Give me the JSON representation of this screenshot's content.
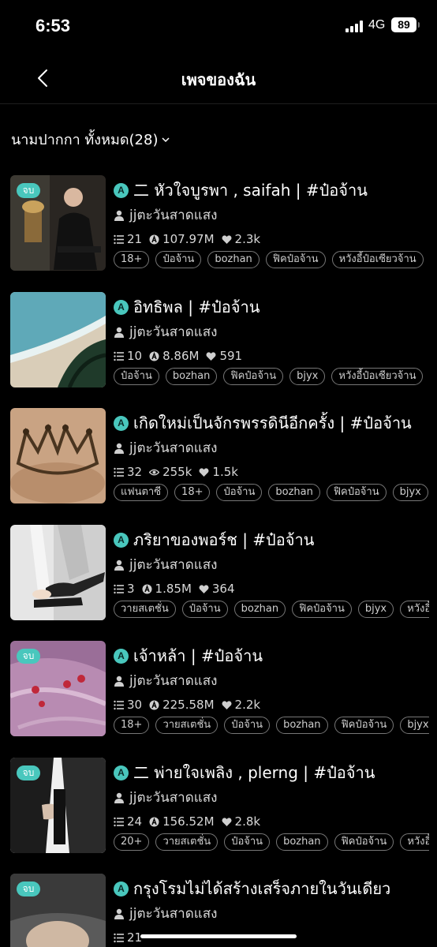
{
  "status_bar": {
    "time": "6:53",
    "network": "4G",
    "battery": "89"
  },
  "nav": {
    "title": "เพจของฉัน"
  },
  "filter": {
    "label": "นามปากกา ทั้งหมด(28)"
  },
  "colors": {
    "accent": "#49c7bd",
    "background": "#000000"
  },
  "stories": [
    {
      "badge": "จบ",
      "title": "二 หัวใจบูรพา , saifah | #ป๋อจ้าน",
      "author": "jjตะวันสาดแสง",
      "chapters": "21",
      "views_icon": "a-coin-icon",
      "views": "107.97M",
      "likes": "2.3k",
      "tags": [
        "18+",
        "ป๋อจ้าน",
        "bozhan",
        "ฟิคป๋อจ้าน",
        "หวังอี้ป๋อเซียวจ้าน"
      ]
    },
    {
      "badge": "",
      "title": "อิทธิพล | #ป๋อจ้าน",
      "author": "jjตะวันสาดแสง",
      "chapters": "10",
      "views_icon": "a-coin-icon",
      "views": "8.86M",
      "likes": "591",
      "tags": [
        "ป๋อจ้าน",
        "bozhan",
        "ฟิคป๋อจ้าน",
        "bjyx",
        "หวังอี้ป๋อเซียวจ้าน"
      ]
    },
    {
      "badge": "",
      "title": "เกิดใหม่เป็นจักรพรรดินีอีกครั้ง | #ป๋อจ้าน",
      "author": "jjตะวันสาดแสง",
      "chapters": "32",
      "views_icon": "eye-icon",
      "views": "255k",
      "likes": "1.5k",
      "tags": [
        "แฟนตาซี",
        "18+",
        "ป๋อจ้าน",
        "bozhan",
        "ฟิคป๋อจ้าน",
        "bjyx"
      ]
    },
    {
      "badge": "",
      "title": "ภริยาของพอร์ช | #ป๋อจ้าน",
      "author": "jjตะวันสาดแสง",
      "chapters": "3",
      "views_icon": "a-coin-icon",
      "views": "1.85M",
      "likes": "364",
      "tags": [
        "วายสเตชั่น",
        "ป๋อจ้าน",
        "bozhan",
        "ฟิคป๋อจ้าน",
        "bjyx",
        "หวังอี้"
      ]
    },
    {
      "badge": "จบ",
      "title": "เจ้าหล้า | #ป๋อจ้าน",
      "author": "jjตะวันสาดแสง",
      "chapters": "30",
      "views_icon": "a-coin-icon",
      "views": "225.58M",
      "likes": "2.2k",
      "tags": [
        "18+",
        "วายสเตชั่น",
        "ป๋อจ้าน",
        "bozhan",
        "ฟิคป๋อจ้าน",
        "bjyx"
      ]
    },
    {
      "badge": "จบ",
      "title": "二 พ่ายใจเพลิง , plerng | #ป๋อจ้าน",
      "author": "jjตะวันสาดแสง",
      "chapters": "24",
      "views_icon": "a-coin-icon",
      "views": "156.52M",
      "likes": "2.8k",
      "tags": [
        "20+",
        "วายสเตชั่น",
        "ป๋อจ้าน",
        "bozhan",
        "ฟิคป๋อจ้าน",
        "หวังอี้"
      ]
    },
    {
      "badge": "จบ",
      "title": "กรุงโรมไม่ได้สร้างเสร็จภายในวันเดียว",
      "author": "jjตะวันสาดแสง",
      "chapters": "21",
      "views_icon": "a-coin-icon",
      "views": "",
      "likes": "",
      "tags": []
    }
  ]
}
